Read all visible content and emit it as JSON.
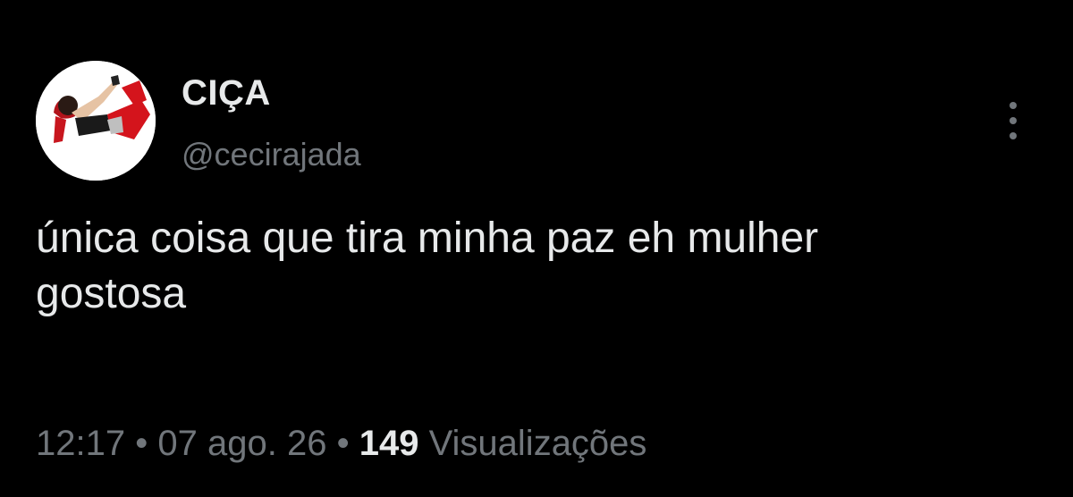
{
  "tweet": {
    "display_name": "CIÇA",
    "handle": "@cecirajada",
    "text": "única coisa que tira minha paz eh mulher\ngostosa",
    "time": "12:17",
    "separator": "•",
    "date": "07 ago. 26",
    "views_count": "149",
    "views_label": "Visualizações"
  },
  "icons": {
    "more": "more-options-icon",
    "avatar": "profile-avatar"
  },
  "colors": {
    "background": "#000000",
    "primary_text": "#e7e9ea",
    "secondary_text": "#71767b"
  }
}
